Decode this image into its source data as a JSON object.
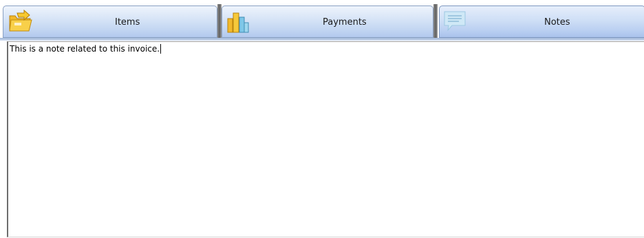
{
  "tabs": [
    {
      "label": "Items",
      "icon": "folder-arrow-icon",
      "active": false
    },
    {
      "label": "Payments",
      "icon": "bar-chart-icon",
      "active": false
    },
    {
      "label": "Notes",
      "icon": "speech-bubble-icon",
      "active": true
    }
  ],
  "notes": {
    "text": "This is a note related to this invoice."
  },
  "colors": {
    "tab_gradient_top": "#eef4fc",
    "tab_gradient_bottom": "#b2c9ee",
    "tab_border": "#8aa0c2",
    "separator": "#5f5f5f"
  }
}
